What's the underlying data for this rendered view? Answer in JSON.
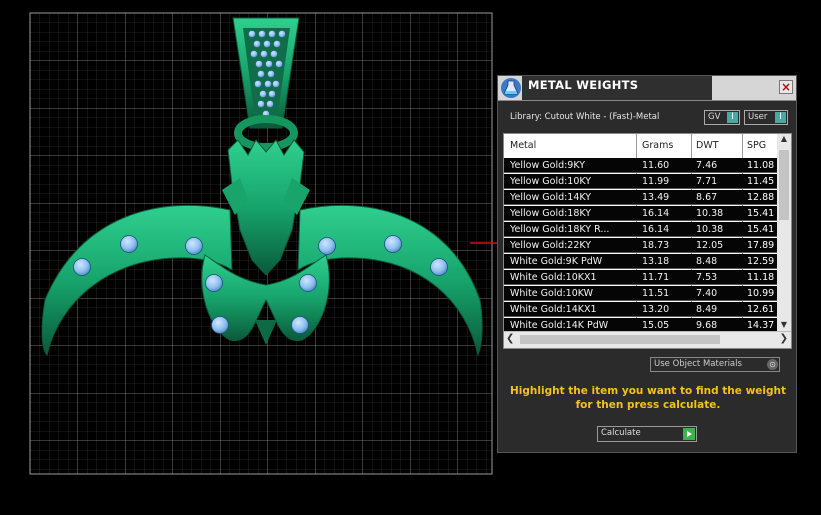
{
  "panel": {
    "title": "METAL WEIGHTS",
    "close_label": "×",
    "library_label": "Library: Cutout White - (Fast)-Metal",
    "gv_label": "GV",
    "user_label": "User",
    "toggle_symbol": "I",
    "use_materials_label": "Use Object Materials",
    "instruction": "Highlight the item you want to find the weight for then press calculate.",
    "calculate_label": "Calculate"
  },
  "table": {
    "columns": [
      "Metal",
      "Grams",
      "DWT",
      "SPG"
    ],
    "rows": [
      [
        "Yellow Gold:9KY",
        "11.60",
        "7.46",
        "11.08"
      ],
      [
        "Yellow Gold:10KY",
        "11.99",
        "7.71",
        "11.45"
      ],
      [
        "Yellow Gold:14KY",
        "13.49",
        "8.67",
        "12.88"
      ],
      [
        "Yellow Gold:18KY",
        "16.14",
        "10.38",
        "15.41"
      ],
      [
        "Yellow Gold:18KY R...",
        "16.14",
        "10.38",
        "15.41"
      ],
      [
        "Yellow Gold:22KY",
        "18.73",
        "12.05",
        "17.89"
      ],
      [
        "White Gold:9K PdW",
        "13.18",
        "8.48",
        "12.59"
      ],
      [
        "White Gold:10KX1",
        "11.71",
        "7.53",
        "11.18"
      ],
      [
        "White Gold:10KW",
        "11.51",
        "7.40",
        "10.99"
      ],
      [
        "White Gold:14KX1",
        "13.20",
        "8.49",
        "12.61"
      ],
      [
        "White Gold:14K PdW",
        "15.05",
        "9.68",
        "14.37"
      ]
    ]
  },
  "colors": {
    "model_green": "#1fa06c",
    "gem_blue": "#8cc2f0",
    "instruction_yellow": "#f2c21c",
    "grid": "#8a8a8a"
  }
}
